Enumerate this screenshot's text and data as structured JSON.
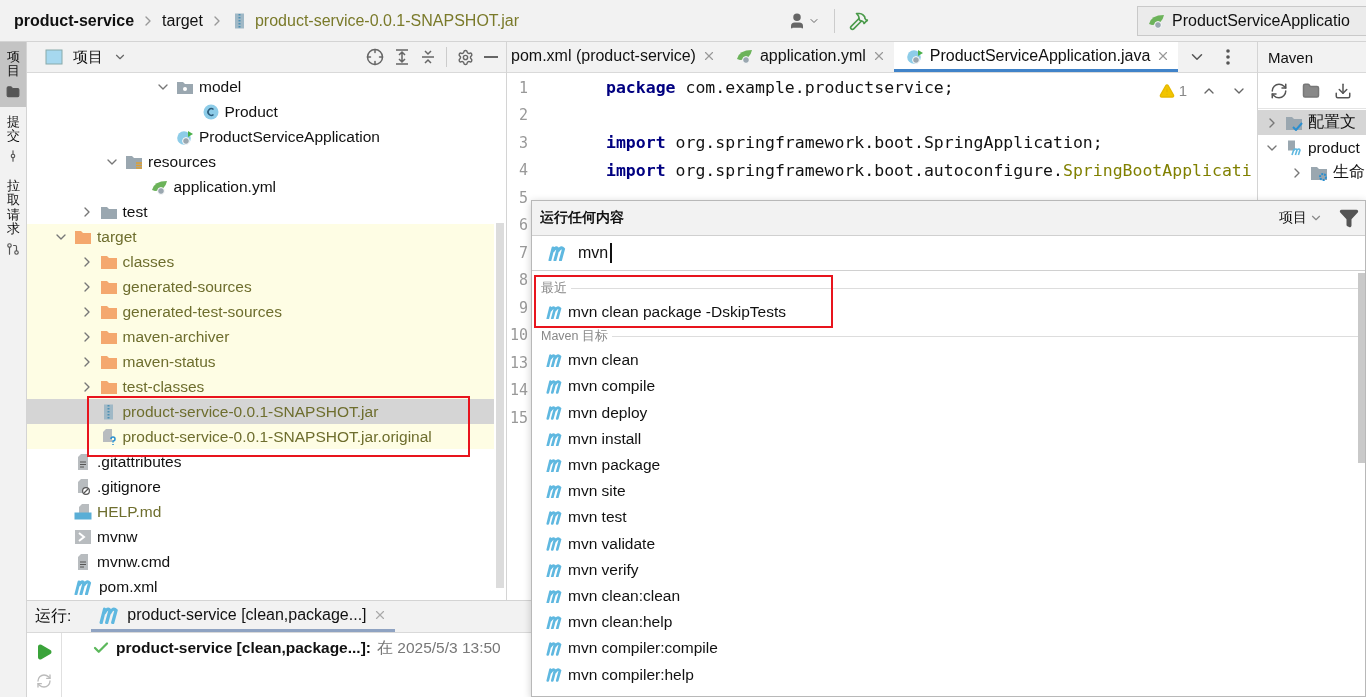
{
  "breadcrumb": [
    {
      "label": "product-service",
      "kind": "project"
    },
    {
      "label": "target",
      "kind": "folder"
    },
    {
      "label": "product-service-0.0.1-SNAPSHOT.jar",
      "kind": "jar"
    }
  ],
  "run_config": "ProductServiceApplicatio",
  "side_tabs": [
    {
      "label": "项目",
      "selected": true
    },
    {
      "label": "提交",
      "selected": false
    },
    {
      "label": "拉取请求",
      "selected": false
    }
  ],
  "project_panel": {
    "title": "项目",
    "tree": [
      {
        "children": [
          {
            "children": [
              {
                "children": [
                  {
                    "children": [
                      {
                        "label": "model",
                        "kind": "package",
                        "expanded": true,
                        "selected": false,
                        "ignored": false,
                        "children": [
                          {
                            "label": "Product",
                            "kind": "class",
                            "selected": false,
                            "ignored": false
                          }
                        ]
                      },
                      {
                        "label": "ProductServiceApplication",
                        "kind": "spring-class",
                        "selected": false,
                        "ignored": false
                      }
                    ]
                  }
                ]
              },
              {
                "label": "resources",
                "kind": "resources",
                "expanded": true,
                "selected": false,
                "ignored": false,
                "children": [
                  {
                    "label": "application.yml",
                    "kind": "yml",
                    "selected": false,
                    "ignored": false
                  }
                ]
              }
            ]
          },
          {
            "label": "test",
            "kind": "folder",
            "expanded": false,
            "selected": false,
            "ignored": false
          }
        ]
      },
      {
        "label": "target",
        "kind": "excluded",
        "expanded": true,
        "selected": false,
        "ignored": true,
        "children": [
          {
            "label": "classes",
            "kind": "excluded",
            "expanded": false,
            "selected": false,
            "ignored": true
          },
          {
            "label": "generated-sources",
            "kind": "excluded",
            "expanded": false,
            "selected": false,
            "ignored": true
          },
          {
            "label": "generated-test-sources",
            "kind": "excluded",
            "expanded": false,
            "selected": false,
            "ignored": true
          },
          {
            "label": "maven-archiver",
            "kind": "excluded",
            "expanded": false,
            "selected": false,
            "ignored": true
          },
          {
            "label": "maven-status",
            "kind": "excluded",
            "expanded": false,
            "selected": false,
            "ignored": true
          },
          {
            "label": "test-classes",
            "kind": "excluded",
            "expanded": false,
            "selected": false,
            "ignored": true
          },
          {
            "label": "product-service-0.0.1-SNAPSHOT.jar",
            "kind": "jar",
            "selected": true,
            "ignored": true
          },
          {
            "label": "product-service-0.0.1-SNAPSHOT.jar.original",
            "kind": "unknown",
            "selected": false,
            "ignored": true
          }
        ]
      },
      {
        "label": ".gitattributes",
        "kind": "text",
        "selected": false,
        "ignored": false
      },
      {
        "label": ".gitignore",
        "kind": "gitignore",
        "selected": false,
        "ignored": false
      },
      {
        "label": "HELP.md",
        "kind": "md",
        "selected": false,
        "ignored": true
      },
      {
        "label": "mvnw",
        "kind": "shell",
        "selected": false,
        "ignored": false
      },
      {
        "label": "mvnw.cmd",
        "kind": "text",
        "selected": false,
        "ignored": false
      },
      {
        "label": "pom.xml",
        "kind": "maven",
        "selected": false,
        "ignored": false
      }
    ]
  },
  "editor": {
    "tabs": [
      {
        "label": "pom.xml (product-service)",
        "kind": "plain",
        "selected": false
      },
      {
        "label": "application.yml",
        "kind": "yml",
        "selected": false
      },
      {
        "label": "ProductServiceApplication.java",
        "kind": "spring-class",
        "selected": true
      }
    ],
    "warnings": "1",
    "lines": [
      {
        "number": "1",
        "tokens": [
          {
            "kind": "keyword",
            "text": "package"
          },
          {
            "kind": "plain",
            "text": " com.example.productservice;"
          }
        ]
      },
      {
        "number": "2"
      },
      {
        "number": "3",
        "tokens": [
          {
            "kind": "keyword",
            "text": "import"
          },
          {
            "kind": "plain",
            "text": " org.springframework.boot.SpringApplication;"
          }
        ]
      },
      {
        "number": "4",
        "tokens": [
          {
            "kind": "keyword",
            "text": "import"
          },
          {
            "kind": "plain",
            "text": " org.springframework.boot.autoconfigure."
          },
          {
            "kind": "annotation",
            "text": "SpringBootApplicati"
          }
        ]
      },
      {
        "number": "5"
      },
      {
        "number": "6"
      },
      {
        "number": "7"
      },
      {
        "number": "8"
      },
      {
        "number": "9"
      },
      {
        "number": "10"
      },
      {
        "number": "13"
      },
      {
        "number": "14"
      },
      {
        "number": "15"
      }
    ]
  },
  "maven": {
    "title": "Maven",
    "tree": [
      {
        "label": "配置文",
        "kind": "profiles",
        "expanded": false,
        "selected": true
      },
      {
        "label": "product",
        "kind": "module",
        "expanded": true,
        "selected": false,
        "children": [
          {
            "label": "生命",
            "kind": "lifecycle",
            "expanded": false,
            "selected": false
          }
        ]
      }
    ]
  },
  "run_panel": {
    "label": "运行:",
    "tab": "product-service [clean,package...]",
    "result": {
      "success": true,
      "title": "product-service [clean,package...]:",
      "time": "在 2025/5/3 13:50"
    }
  },
  "run_anything": {
    "title": "运行任何内容",
    "scope": "项目",
    "query": "mvn",
    "sections": [
      {
        "title": "最近",
        "items": [
          "mvn clean package -DskipTests"
        ]
      },
      {
        "title": "Maven 目标",
        "items": [
          "mvn clean",
          "mvn compile",
          "mvn deploy",
          "mvn install",
          "mvn package",
          "mvn site",
          "mvn test",
          "mvn validate",
          "mvn verify",
          "mvn clean:clean",
          "mvn clean:help",
          "mvn compiler:compile",
          "mvn compiler:help"
        ]
      }
    ]
  }
}
